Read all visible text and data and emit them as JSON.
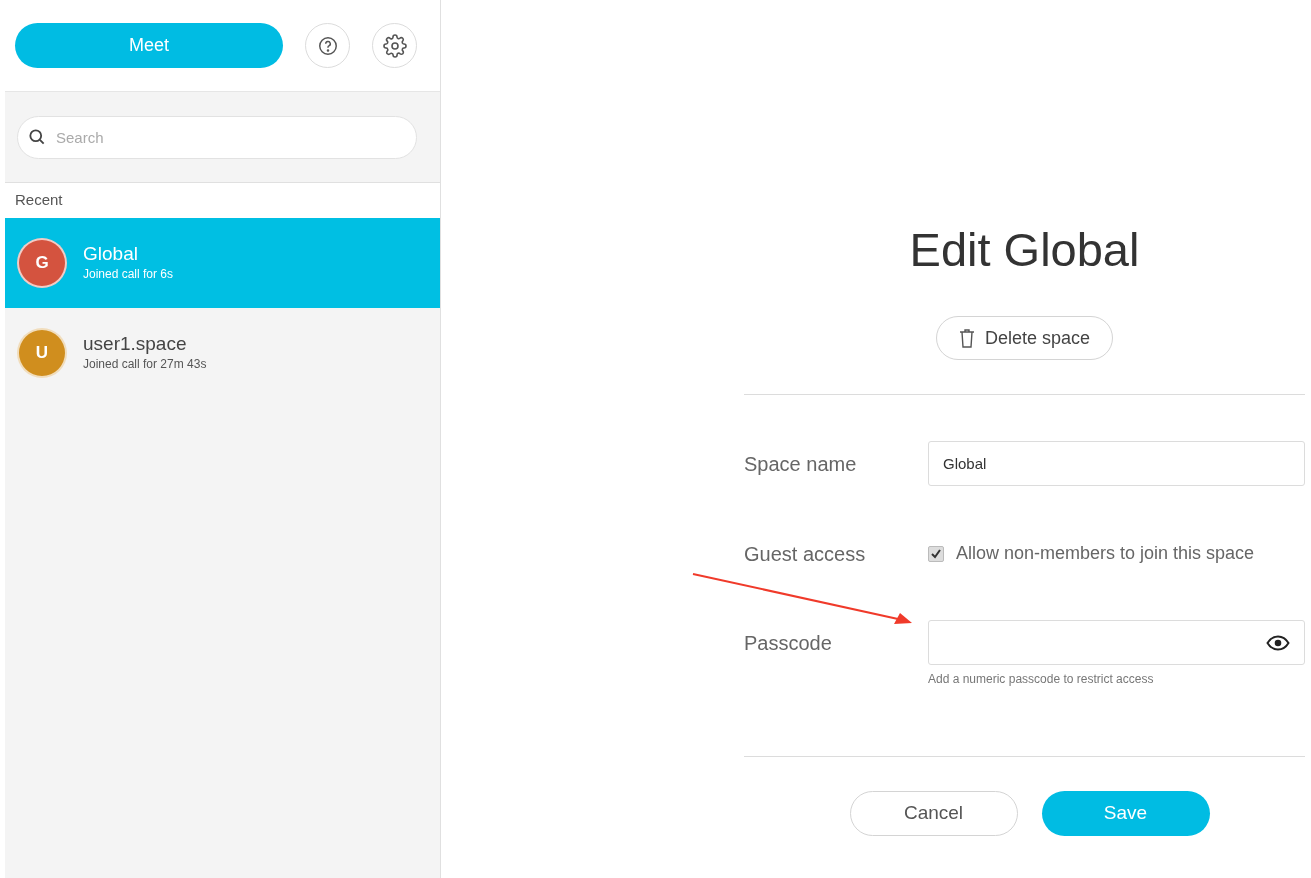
{
  "sidebar": {
    "meet_button": "Meet",
    "search": {
      "placeholder": "Search"
    },
    "section_label": "Recent",
    "spaces": [
      {
        "initial": "G",
        "color": "#d4533f",
        "name": "Global",
        "status": "Joined call for 6s",
        "selected": true
      },
      {
        "initial": "U",
        "color": "#d08e1e",
        "name": "user1.space",
        "status": "Joined call for 27m 43s",
        "selected": false
      }
    ]
  },
  "dialog": {
    "title": "Edit Global",
    "delete_button": "Delete space",
    "space_name": {
      "label": "Space name",
      "value": "Global"
    },
    "guest_access": {
      "label": "Guest access",
      "text": "Allow non-members to join this space",
      "checked": true
    },
    "passcode": {
      "label": "Passcode",
      "hint": "Add a numeric passcode to restrict access"
    },
    "buttons": {
      "cancel": "Cancel",
      "save": "Save"
    }
  }
}
